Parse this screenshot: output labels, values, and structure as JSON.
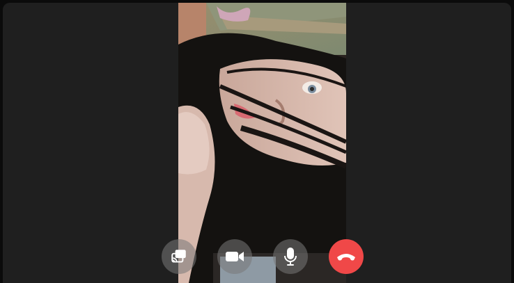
{
  "call": {
    "controls": [
      {
        "id": "screen-share",
        "icon": "cast-icon"
      },
      {
        "id": "camera",
        "icon": "video-camera-icon"
      },
      {
        "id": "microphone",
        "icon": "microphone-icon"
      },
      {
        "id": "end-call",
        "icon": "hang-up-icon"
      }
    ]
  },
  "colors": {
    "background": "#1f1f1f",
    "control_button": "#787878",
    "end_call_button": "#f04848",
    "icon": "#ffffff"
  }
}
